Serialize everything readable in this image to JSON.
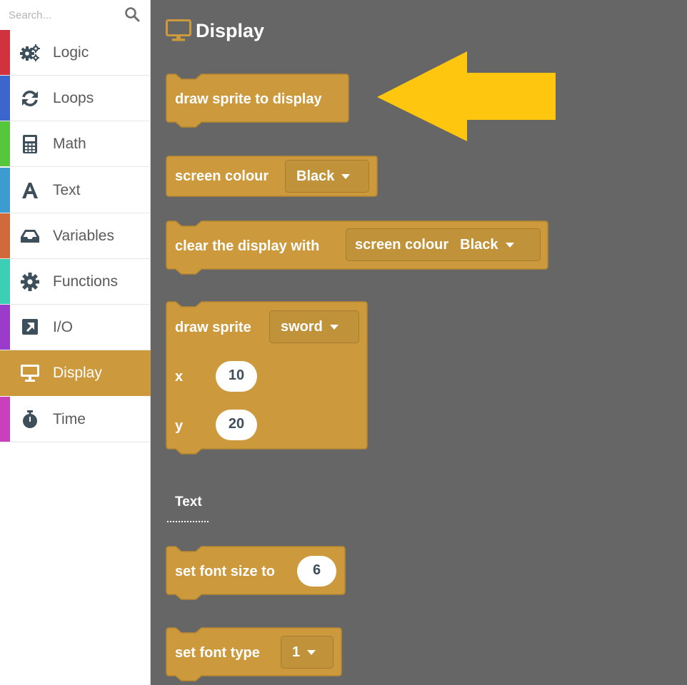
{
  "search": {
    "placeholder": "Search..."
  },
  "categories": [
    {
      "label": "Logic",
      "color": "#d1323e",
      "icon": "gears-icon"
    },
    {
      "label": "Loops",
      "color": "#3c66cc",
      "icon": "refresh-icon"
    },
    {
      "label": "Math",
      "color": "#56c73c",
      "icon": "calculator-icon"
    },
    {
      "label": "Text",
      "color": "#3d9ccf",
      "icon": "letter-a-icon"
    },
    {
      "label": "Variables",
      "color": "#d06a3b",
      "icon": "inbox-icon"
    },
    {
      "label": "Functions",
      "color": "#3dcfb5",
      "icon": "gear-icon"
    },
    {
      "label": "I/O",
      "color": "#9a3bcb",
      "icon": "external-link-icon"
    },
    {
      "label": "Display",
      "color": "#cc9a3c",
      "icon": "monitor-icon"
    },
    {
      "label": "Time",
      "color": "#c93fbd",
      "icon": "stopwatch-icon"
    }
  ],
  "active_category": "Display",
  "flyout": {
    "title": "Display",
    "block_color": "#cc9a3c",
    "blocks": {
      "draw_sprite_to_display": {
        "label": "draw sprite to display"
      },
      "screen_colour": {
        "label": "screen colour",
        "dropdown": "Black"
      },
      "clear_display": {
        "label": "clear the display with",
        "inner_label": "screen colour",
        "inner_dropdown": "Black"
      },
      "draw_sprite": {
        "label": "draw sprite",
        "dropdown": "sword",
        "x_label": "x",
        "x_value": "10",
        "y_label": "y",
        "y_value": "20"
      },
      "set_font_size": {
        "label": "set font size to",
        "value": "6"
      },
      "set_font_type": {
        "label": "set font type",
        "dropdown": "1"
      }
    },
    "section_label": "Text"
  },
  "arrow_color": "#fec60e"
}
